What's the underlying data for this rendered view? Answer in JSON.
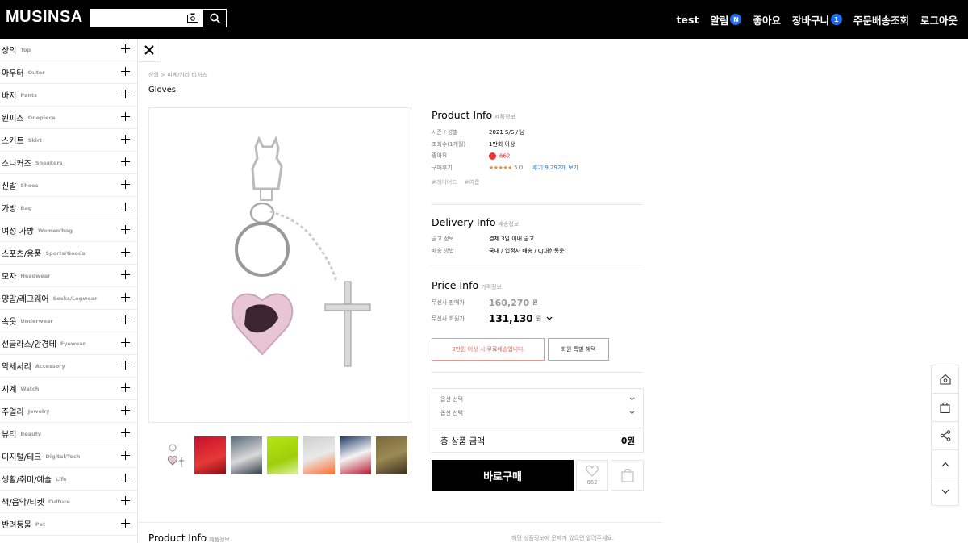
{
  "header": {
    "logo": "MUSINSA",
    "nav": {
      "user": "test",
      "alerts": "알림",
      "alerts_badge": "N",
      "likes": "좋아요",
      "cart": "장바구니",
      "cart_badge": "1",
      "orders": "주문배송조회",
      "logout": "로그아웃"
    }
  },
  "sidebar": {
    "categories": [
      {
        "ko": "상의",
        "en": "Top"
      },
      {
        "ko": "아우터",
        "en": "Outer"
      },
      {
        "ko": "바지",
        "en": "Pants"
      },
      {
        "ko": "원피스",
        "en": "Onepiece"
      },
      {
        "ko": "스커트",
        "en": "Skirt"
      },
      {
        "ko": "스니커즈",
        "en": "Sneakers"
      },
      {
        "ko": "신발",
        "en": "Shoes"
      },
      {
        "ko": "가방",
        "en": "Bag"
      },
      {
        "ko": "여성 가방",
        "en": "Women'bag"
      },
      {
        "ko": "스포츠/용품",
        "en": "Sports/Goods"
      },
      {
        "ko": "모자",
        "en": "Headwear"
      },
      {
        "ko": "양말/레그웨어",
        "en": "Socks/Legwear"
      },
      {
        "ko": "속옷",
        "en": "Underwear"
      },
      {
        "ko": "선글라스/안경테",
        "en": "Eyewear"
      },
      {
        "ko": "악세서리",
        "en": "Accessory"
      },
      {
        "ko": "시계",
        "en": "Watch"
      },
      {
        "ko": "주얼리",
        "en": "Jewelry"
      },
      {
        "ko": "뷰티",
        "en": "Beauty"
      },
      {
        "ko": "디지털/테크",
        "en": "Digital/Tech"
      },
      {
        "ko": "생활/취미/예술",
        "en": "Life"
      },
      {
        "ko": "책/음악/티켓",
        "en": "Culture"
      },
      {
        "ko": "반려동물",
        "en": "Pet"
      }
    ]
  },
  "product": {
    "breadcrumb": "상의 > 피케/카라 티셔츠",
    "title": "Gloves"
  },
  "product_info": {
    "title": "Product Info",
    "sub": "제품정보",
    "season_label": "시즌 / 성별",
    "season_value": "2021 S/S / 남",
    "views_label": "조회수(1개월)",
    "views_value": "1만회 이상",
    "likes_label": "좋아요",
    "likes_value": "662",
    "review_label": "구매후기",
    "review_stars": "★★★★★",
    "review_score": "5.0",
    "review_link": "후기 9,292개 보기",
    "tag1": "#레이어드",
    "tag2": "#여름"
  },
  "delivery_info": {
    "title": "Delivery Info",
    "sub": "배송정보",
    "ship_label": "출고 정보",
    "ship_value": "결제 3일 이내 출고",
    "method_label": "배송 방법",
    "method_value": "국내 / 입점사 배송 / CJ대한통운"
  },
  "price_info": {
    "title": "Price Info",
    "sub": "가격정보",
    "sale_label": "무신사 판매가",
    "sale_value": "160,270",
    "won": "원",
    "member_label": "무신사 회원가",
    "member_value": "131,130",
    "free_ship": "3만원 이상 시 무료배송입니다.",
    "member_benefit": "회원 특별 혜택"
  },
  "options": {
    "select1": "옵션 선택",
    "select2": "옵션 선택",
    "total_label": "총 상품 금액",
    "total_value": "0원"
  },
  "actions": {
    "buy": "바로구매",
    "like_count": "662"
  },
  "bottom": {
    "title": "Product Info",
    "sub": "제품정보",
    "note": "해당 상품정보에 문제가 있으면 알려주세요."
  },
  "colors": {
    "accent_pink": "#ff2d76",
    "badge_blue": "#1f6ff2",
    "link_blue": "#0078ff",
    "star_orange": "#f08a2b"
  },
  "icons": [
    "camera-icon",
    "search-icon",
    "close-icon",
    "heart-icon",
    "cart-icon",
    "home-icon",
    "bag-icon",
    "share-icon",
    "arrow-up-icon",
    "arrow-down-icon",
    "chevron-down-icon"
  ]
}
